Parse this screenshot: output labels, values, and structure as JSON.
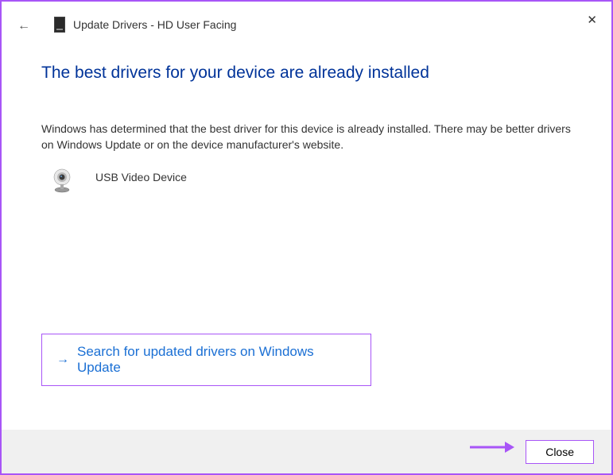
{
  "window": {
    "title": "Update Drivers - HD User Facing"
  },
  "main": {
    "heading": "The best drivers for your device are already installed",
    "description": "Windows has determined that the best driver for this device is already installed. There may be better drivers on Windows Update or on the device manufacturer's website.",
    "device_name": "USB Video Device",
    "search_link": "Search for updated drivers on Windows Update"
  },
  "footer": {
    "close_label": "Close"
  }
}
